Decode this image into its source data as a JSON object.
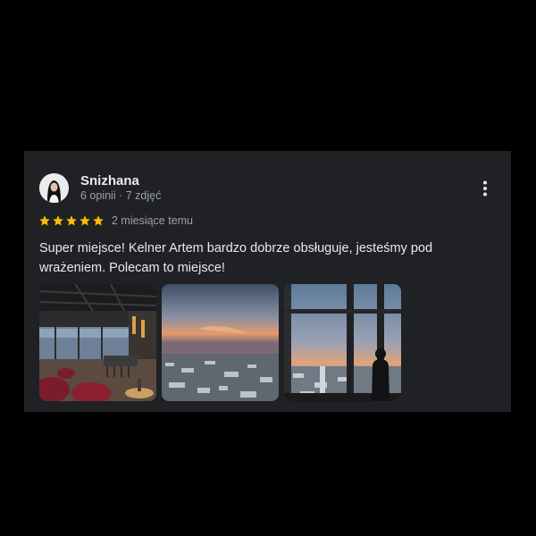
{
  "review": {
    "author": "Snizhana",
    "meta": "6 opinii · 7 zdjęć",
    "rating": 5,
    "time": "2 miesiące temu",
    "text": "Super miejsce! Kelner Artem bardzo dobrze obsługuje, jesteśmy pod wrażeniem. Polecam to miejsce!",
    "photos": [
      {
        "icon": "restaurant-interior-photo"
      },
      {
        "icon": "sunset-city-view-photo"
      },
      {
        "icon": "window-view-person-photo"
      }
    ]
  },
  "colors": {
    "card_bg": "#202124",
    "page_bg": "#000000",
    "text_primary": "#e8eaed",
    "text_secondary": "#9aa0a6",
    "star": "#fbbc04"
  }
}
